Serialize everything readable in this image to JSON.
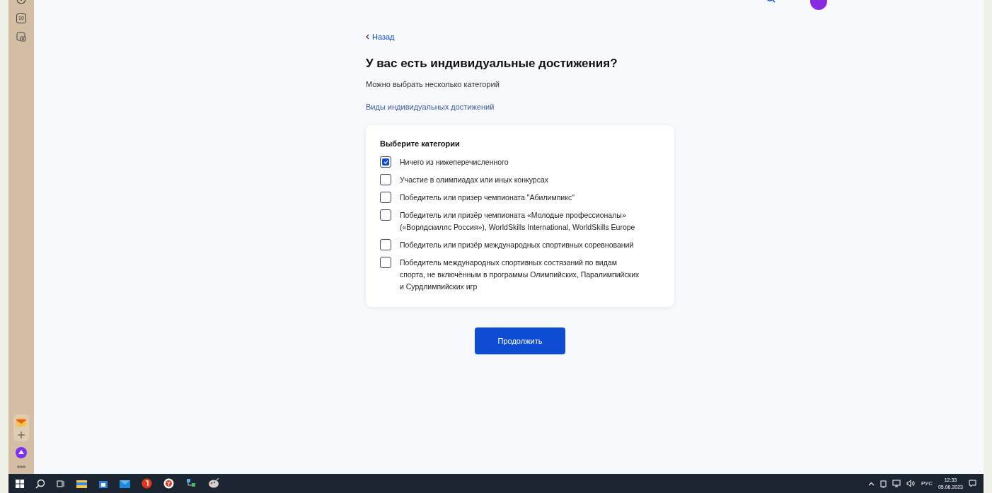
{
  "sidebar": {
    "badge": "10"
  },
  "back_link": "Назад",
  "title": "У вас есть индивидуальные достижения?",
  "subtitle": "Можно выбрать несколько категорий",
  "info_link": "Виды индивидуальных достижений",
  "card": {
    "heading": "Выберите категории",
    "options": [
      {
        "label": "Ничего из нижеперечисленного",
        "checked": true
      },
      {
        "label": "Участие в олимпиадах или иных конкурсах",
        "checked": false
      },
      {
        "label": "Победитель или призер чемпионата \"Абилимпикс\"",
        "checked": false
      },
      {
        "label": "Победитель или призёр чемпионата «Молодые профессионалы» («Ворлдскиллс Россия»), WorldSkills International, WorldSkills Europe",
        "checked": false
      },
      {
        "label": "Победитель или призёр международных спортивных соревнований",
        "checked": false
      },
      {
        "label": "Победитель международных спортивных состязаний по видам спорта, не включённым в программы Олимпийских, Паралимпийских и Сурдлимпийских игр",
        "checked": false
      }
    ]
  },
  "continue_button": "Продолжить",
  "taskbar": {
    "language": "РУС",
    "time": "12:33",
    "date": "05.06.2023"
  }
}
